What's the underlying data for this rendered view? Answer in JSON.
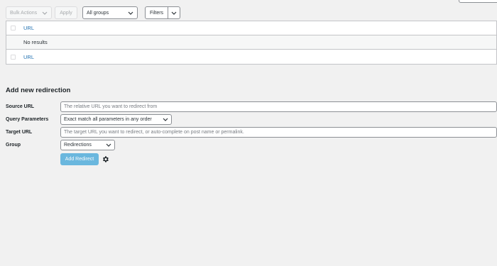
{
  "toolbar": {
    "bulk_actions": "Bulk Actions",
    "apply": "Apply",
    "groups": "All groups",
    "filters": "Filters"
  },
  "table": {
    "header_col": "URL",
    "no_results": "No results",
    "footer_col": "URL"
  },
  "form": {
    "title": "Add new redirection",
    "source_label": "Source URL",
    "source_placeholder": "The relative URL you want to redirect from",
    "query_label": "Query Parameters",
    "query_value": "Exact match all parameters in any order",
    "target_label": "Target URL",
    "target_placeholder": "The target URL you want to redirect, or auto-complete on post name or permalink.",
    "group_label": "Group",
    "group_value": "Redirections",
    "add_button": "Add Redirect"
  },
  "icons": {
    "chevron": "chevron-down-icon",
    "gear": "gear-icon"
  },
  "colors": {
    "link": "#2271b1",
    "primary_button": "#3ea4d8",
    "background": "#f1f1f1"
  }
}
